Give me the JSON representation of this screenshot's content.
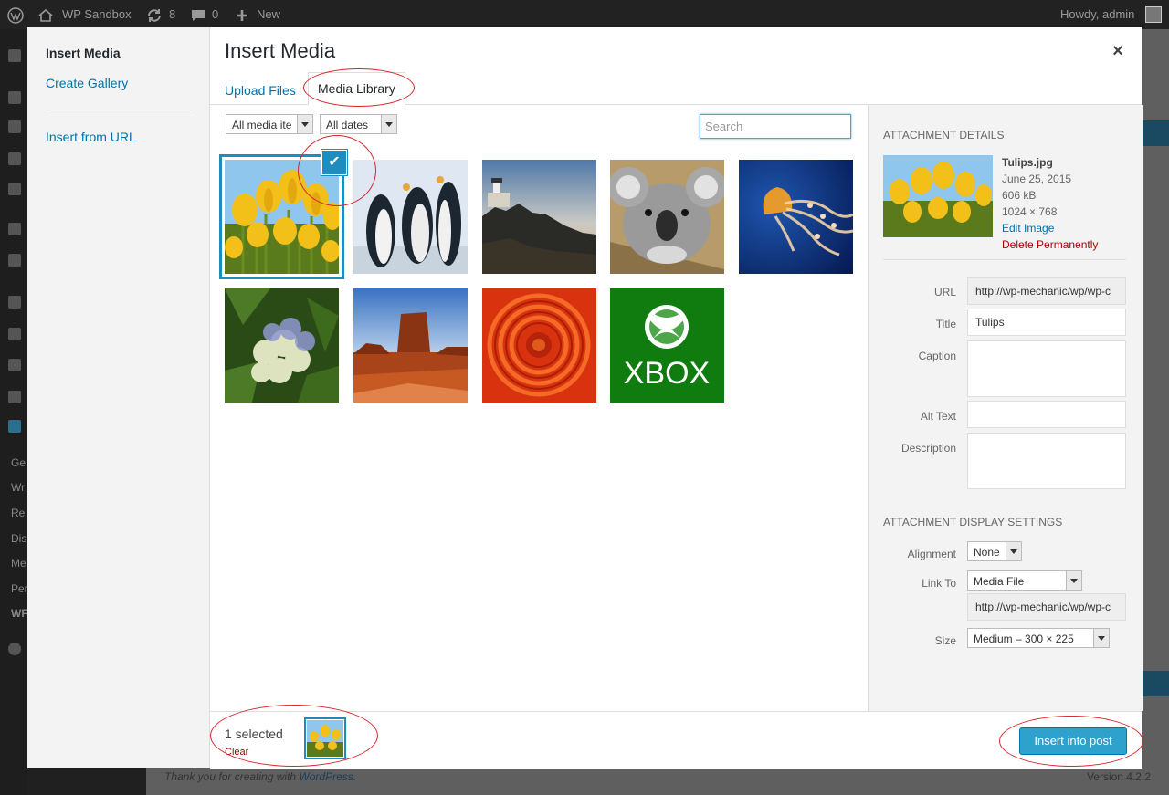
{
  "admin_bar": {
    "site_name": "WP Sandbox",
    "updates_count": "8",
    "comments_count": "0",
    "new_label": "New",
    "howdy": "Howdy, admin"
  },
  "admin_menu_fragments": [
    "Ge",
    "Wr",
    "Re",
    "Dis",
    "Me",
    "Per",
    "WF"
  ],
  "footer": {
    "thanks_prefix": "Thank you for creating with ",
    "thanks_link": "WordPress",
    "thanks_suffix": ".",
    "version": "Version 4.2.2"
  },
  "media_menu": {
    "heading": "Insert Media",
    "items": [
      "Create Gallery",
      "Insert from URL"
    ]
  },
  "frame": {
    "title": "Insert Media",
    "close_glyph": "×",
    "tabs": [
      "Upload Files",
      "Media Library"
    ],
    "active_tab": "Media Library"
  },
  "filters": {
    "type": "All media ite",
    "date": "All dates",
    "search_placeholder": "Search"
  },
  "attachments": [
    {
      "name": "tulips",
      "selected": true
    },
    {
      "name": "penguins",
      "selected": false
    },
    {
      "name": "lighthouse",
      "selected": false
    },
    {
      "name": "koala",
      "selected": false
    },
    {
      "name": "jellyfish",
      "selected": false
    },
    {
      "name": "hydrangeas",
      "selected": false
    },
    {
      "name": "desert",
      "selected": false
    },
    {
      "name": "chrysanthemum",
      "selected": false
    },
    {
      "name": "xbox",
      "selected": false,
      "text": "XBOX"
    }
  ],
  "details": {
    "heading": "ATTACHMENT DETAILS",
    "filename": "Tulips.jpg",
    "date": "June 25, 2015",
    "filesize": "606 kB",
    "dimensions": "1024 × 768",
    "edit_link": "Edit Image",
    "delete_link": "Delete Permanently",
    "fields": {
      "url_label": "URL",
      "url_value": "http://wp-mechanic/wp/wp-c",
      "title_label": "Title",
      "title_value": "Tulips",
      "caption_label": "Caption",
      "alt_label": "Alt Text",
      "description_label": "Description"
    }
  },
  "display_settings": {
    "heading": "ATTACHMENT DISPLAY SETTINGS",
    "alignment_label": "Alignment",
    "alignment_value": "None",
    "link_label": "Link To",
    "link_value": "Media File",
    "link_url": "http://wp-mechanic/wp/wp-c",
    "size_label": "Size",
    "size_value": "Medium – 300 × 225"
  },
  "bottom": {
    "selected_count": "1 selected",
    "clear_label": "Clear",
    "insert_button": "Insert into post"
  },
  "colors": {
    "accent": "#1e8cbe",
    "link": "#0073aa",
    "danger": "#a00",
    "primary_button": "#2ea2cc",
    "annotation": "#d9242b"
  }
}
